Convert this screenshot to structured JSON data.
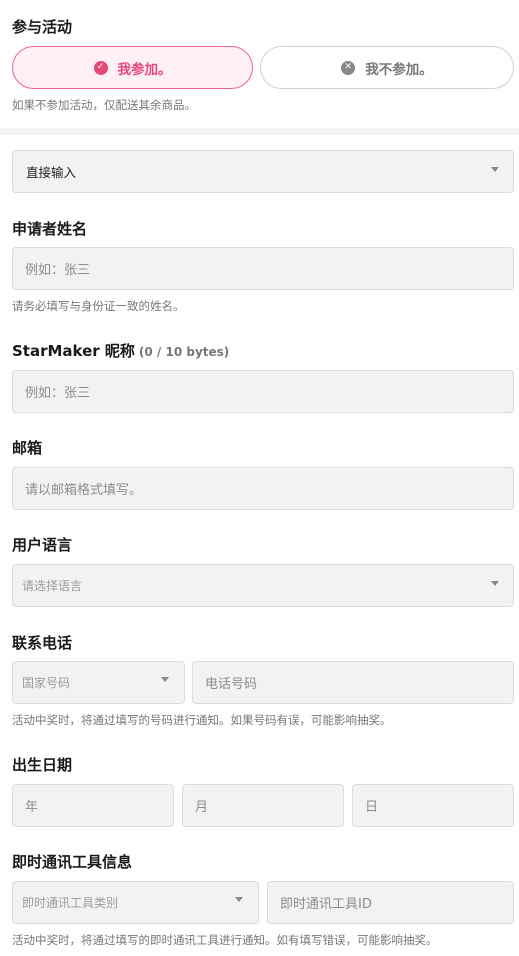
{
  "participate": {
    "title": "参与活动",
    "yes_label": "我参加。",
    "no_label": "我不参加。",
    "helper": "如果不参加活动，仅配送其余商品。"
  },
  "input_method": {
    "value": "直接输入"
  },
  "applicant_name": {
    "title": "申请者姓名",
    "placeholder": "例如：张三",
    "helper": "请务必填写与身份证一致的姓名。"
  },
  "nickname": {
    "title": "StarMaker 昵称",
    "byte_count": "(0 / 10 bytes)",
    "placeholder": "例如：张三"
  },
  "email": {
    "title": "邮箱",
    "placeholder": "请以邮箱格式填写。"
  },
  "language": {
    "title": "用户语言",
    "placeholder": "请选择语言"
  },
  "phone": {
    "title": "联系电话",
    "country_placeholder": "国家号码",
    "number_placeholder": "电话号码",
    "helper": "活动中奖时，将通过填写的号码进行通知。如果号码有误，可能影响抽奖。"
  },
  "birthdate": {
    "title": "出生日期",
    "year_placeholder": "年",
    "month_placeholder": "月",
    "day_placeholder": "日"
  },
  "messenger": {
    "title": "即时通讯工具信息",
    "type_placeholder": "即时通讯工具类别",
    "id_placeholder": "即时通讯工具ID",
    "helper": "活动中奖时，将通过填写的即时通讯工具进行通知。如有填写错误，可能影响抽奖。"
  },
  "icons": {
    "check": "check-circle-icon",
    "close": "close-circle-icon",
    "dropdown": "caret-down-icon"
  },
  "colors": {
    "accent": "#e8477a",
    "accent_bg": "#fff0f4",
    "field_bg": "#f2f2f4"
  }
}
